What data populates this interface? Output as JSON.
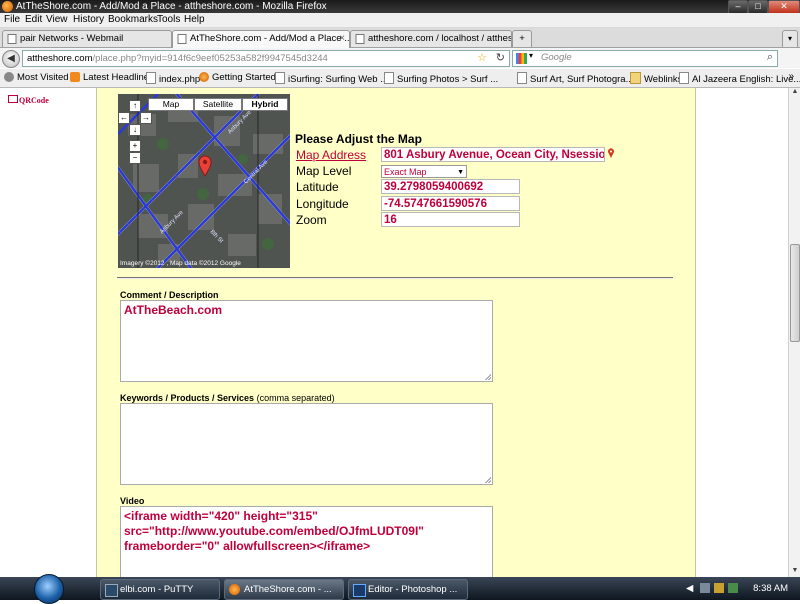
{
  "window": {
    "title": "AtTheShore.com - Add/Mod a Place - attheshore.com - Mozilla Firefox"
  },
  "menu": [
    "File",
    "Edit",
    "View",
    "History",
    "Bookmarks",
    "Tools",
    "Help"
  ],
  "tabs": [
    {
      "label": "pair Networks - Webmail"
    },
    {
      "label": "AtTheShore.com - Add/Mod a Place ..."
    },
    {
      "label": "attheshore.com / localhost / atthesh..."
    }
  ],
  "nav": {
    "url_domain": "attheshore.com",
    "url_path": "/place.php?myid=914f6c9eef05253a582f9947545d3244",
    "search_placeholder": "Google"
  },
  "bookmarks": [
    {
      "label": "Most Visited",
      "icon": "gear-icon"
    },
    {
      "label": "Latest Headlines",
      "icon": "rss-icon"
    },
    {
      "label": "index.php",
      "icon": "page-icon"
    },
    {
      "label": "Getting Started",
      "icon": "firefox-icon"
    },
    {
      "label": "iSurfing: Surfing Web ...",
      "icon": "page-icon"
    },
    {
      "label": "Surfing Photos > Surf ...",
      "icon": "page-icon"
    },
    {
      "label": "Surf Art, Surf Photogra...",
      "icon": "page-icon"
    },
    {
      "label": "Weblinks",
      "icon": "folder-icon"
    },
    {
      "label": "Al Jazeera English: Live...",
      "icon": "page-icon"
    }
  ],
  "sidebar": {
    "qrcode_label": "QRCode"
  },
  "map": {
    "type_buttons": [
      "Map",
      "Satellite",
      "Hybrid"
    ],
    "selected_type": "Hybrid",
    "credit": "Imagery ©2012 , Map data ©2012 Google"
  },
  "adjust": {
    "title": "Please Adjust the Map",
    "address_label": "Map Address",
    "address_value": "801 Asbury Avenue, Ocean City, Nsession",
    "level_label": "Map Level",
    "level_value": "Exact Map",
    "latitude_label": "Latitude",
    "latitude_value": "39.2798059400692",
    "longitude_label": "Longitude",
    "longitude_value": "-74.5747661590576",
    "zoom_label": "Zoom",
    "zoom_value": "16"
  },
  "form": {
    "comment_label": "Comment / Description",
    "comment_value": "AtTheBeach.com",
    "keywords_label": "Keywords / Products / Services",
    "keywords_note": "(comma separated)",
    "keywords_value": "",
    "video_label": "Video",
    "video_value": "<iframe width=\"420\" height=\"315\" src=\"http://www.youtube.com/embed/OJfmLUDT09I\" frameborder=\"0\" allowfullscreen></iframe>"
  },
  "taskbar": {
    "items": [
      {
        "label": "elbi.com - PuTTY"
      },
      {
        "label": "AtTheShore.com - ..."
      },
      {
        "label": "Editor - Photoshop ..."
      }
    ],
    "clock": "8:38 AM"
  },
  "colors": {
    "accent_red": "#c0003a",
    "panel_bg": "#ffffc8"
  }
}
